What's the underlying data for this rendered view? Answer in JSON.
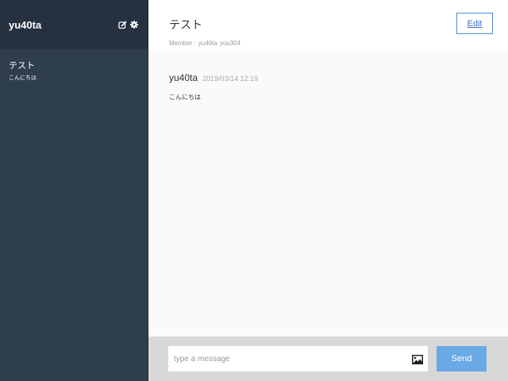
{
  "sidebar": {
    "username": "yu40ta",
    "icons": [
      "edit-icon",
      "gear-icon"
    ],
    "groups": [
      {
        "name": "テスト",
        "last_message": "こんにちは"
      }
    ]
  },
  "chat": {
    "title": "テスト",
    "members_label": "Member :",
    "members": [
      "yu40ta",
      "you304"
    ],
    "edit_label": "Edit",
    "messages": [
      {
        "user": "yu40ta",
        "time": "2019/03/14 12:19",
        "text": "こんにちは"
      }
    ]
  },
  "form": {
    "placeholder": "type a message",
    "image_icon": "image-icon",
    "send_label": "Send"
  },
  "colors": {
    "sidebar_bg": "#2f3e4e",
    "sidebar_header_bg": "#253140",
    "accent": "#69a9e6",
    "edit_border": "#4c8cdb",
    "footer_bg": "#d8d8d8"
  }
}
